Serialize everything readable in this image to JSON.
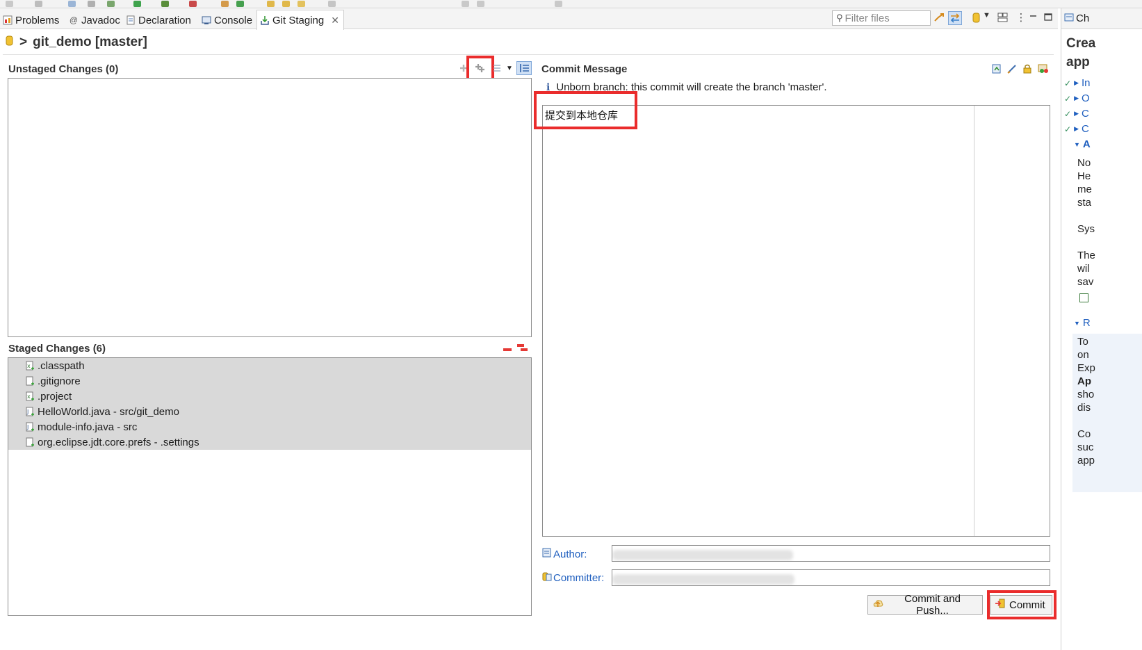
{
  "tabs": [
    {
      "label": "Problems",
      "icon": "problems-icon"
    },
    {
      "label": "Javadoc",
      "icon": "javadoc-icon"
    },
    {
      "label": "Declaration",
      "icon": "declaration-icon"
    },
    {
      "label": "Console",
      "icon": "console-icon"
    },
    {
      "label": "Git Staging",
      "icon": "git-staging-icon",
      "active": true
    }
  ],
  "filter": {
    "placeholder": "Filter files"
  },
  "repo": {
    "prefix": ">",
    "title": "git_demo [master]"
  },
  "unstaged": {
    "title": "Unstaged Changes (0)",
    "files": []
  },
  "staged": {
    "title": "Staged Changes (6)",
    "files": [
      {
        "name": ".classpath",
        "icon": "xml-added-file-icon"
      },
      {
        "name": ".gitignore",
        "icon": "added-file-icon"
      },
      {
        "name": ".project",
        "icon": "xml-added-file-icon"
      },
      {
        "name": "HelloWorld.java - src/git_demo",
        "icon": "java-added-file-icon"
      },
      {
        "name": "module-info.java - src",
        "icon": "java-added-file-icon"
      },
      {
        "name": "org.eclipse.jdt.core.prefs - .settings",
        "icon": "added-file-icon"
      }
    ]
  },
  "commit": {
    "title": "Commit Message",
    "info": "Unborn branch: this commit will create the branch 'master'.",
    "message": "提交到本地仓库",
    "author_label": "Author:",
    "committer_label": "Committer:",
    "commit_push_label": "Commit and Push...",
    "commit_label": "Commit"
  },
  "cheatsheet": {
    "tab_label": "Ch",
    "title_line1": "Crea",
    "title_line2": "app",
    "steps": [
      {
        "label": "In",
        "done": true
      },
      {
        "label": "O",
        "done": true
      },
      {
        "label": "C",
        "done": true
      },
      {
        "label": "C",
        "done": true
      },
      {
        "label": "A",
        "expanded": true
      }
    ],
    "body1": "No\nHe\nme\nsta\n\nSys\n\nThe\nwil\nsav",
    "section2": "R",
    "body2": "To\non\nExp",
    "body2_bold": "Ap",
    "body3": "sho\ndis\n\nCo\nsuc\napp"
  },
  "colors": {
    "highlight_red": "#ea2c2c",
    "link_blue": "#1f5fbf",
    "staged_bg": "#d9d9d9",
    "tab_bg": "#f4f4f4"
  }
}
